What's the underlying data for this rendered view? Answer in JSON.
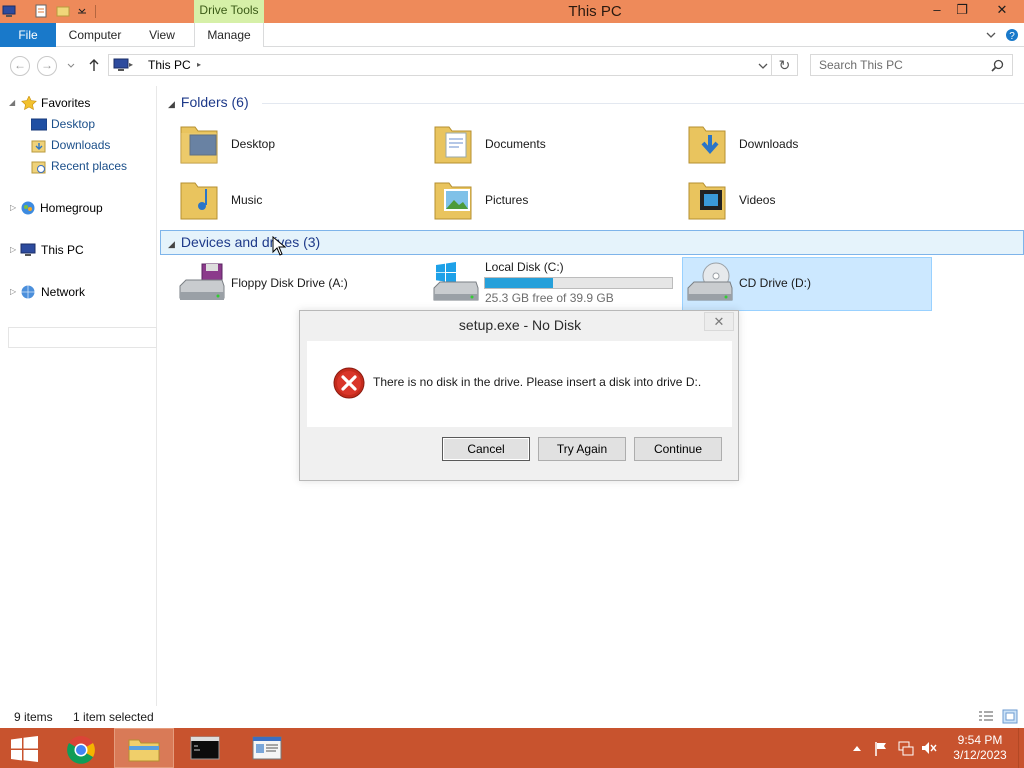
{
  "window": {
    "title": "This PC",
    "context_tab": "Drive Tools",
    "controls": {
      "minimize": "–",
      "restore": "❐",
      "close": "✕"
    }
  },
  "ribbon": {
    "tabs": [
      "File",
      "Computer",
      "View",
      "Manage"
    ]
  },
  "address": {
    "location": "This PC",
    "search_placeholder": "Search This PC"
  },
  "navpane": {
    "favorites_label": "Favorites",
    "favorites": [
      "Desktop",
      "Downloads",
      "Recent places"
    ],
    "homegroup": "Homegroup",
    "this_pc": "This PC",
    "network": "Network"
  },
  "content": {
    "folders_header": "Folders (6)",
    "folders": [
      "Desktop",
      "Documents",
      "Downloads",
      "Music",
      "Pictures",
      "Videos"
    ],
    "devices_header": "Devices and drives (3)",
    "devices": [
      {
        "name": "Floppy Disk Drive (A:)"
      },
      {
        "name": "Local Disk (C:)",
        "detail": "25.3 GB free of 39.9 GB",
        "used_fraction": 0.366
      },
      {
        "name": "CD Drive (D:)"
      }
    ]
  },
  "dialog": {
    "title": "setup.exe - No Disk",
    "message": "There is no disk in the drive. Please insert a disk into drive D:.",
    "buttons": [
      "Cancel",
      "Try Again",
      "Continue"
    ],
    "close": "✕"
  },
  "status": {
    "items": "9 items",
    "selected": "1 item selected"
  },
  "clock": {
    "time": "9:54 PM",
    "date": "3/12/2023"
  },
  "colors": {
    "titlebar": "#ee8a5a",
    "taskbar": "#c8532e",
    "accent": "#1979ca",
    "selection": "#cce8ff"
  }
}
